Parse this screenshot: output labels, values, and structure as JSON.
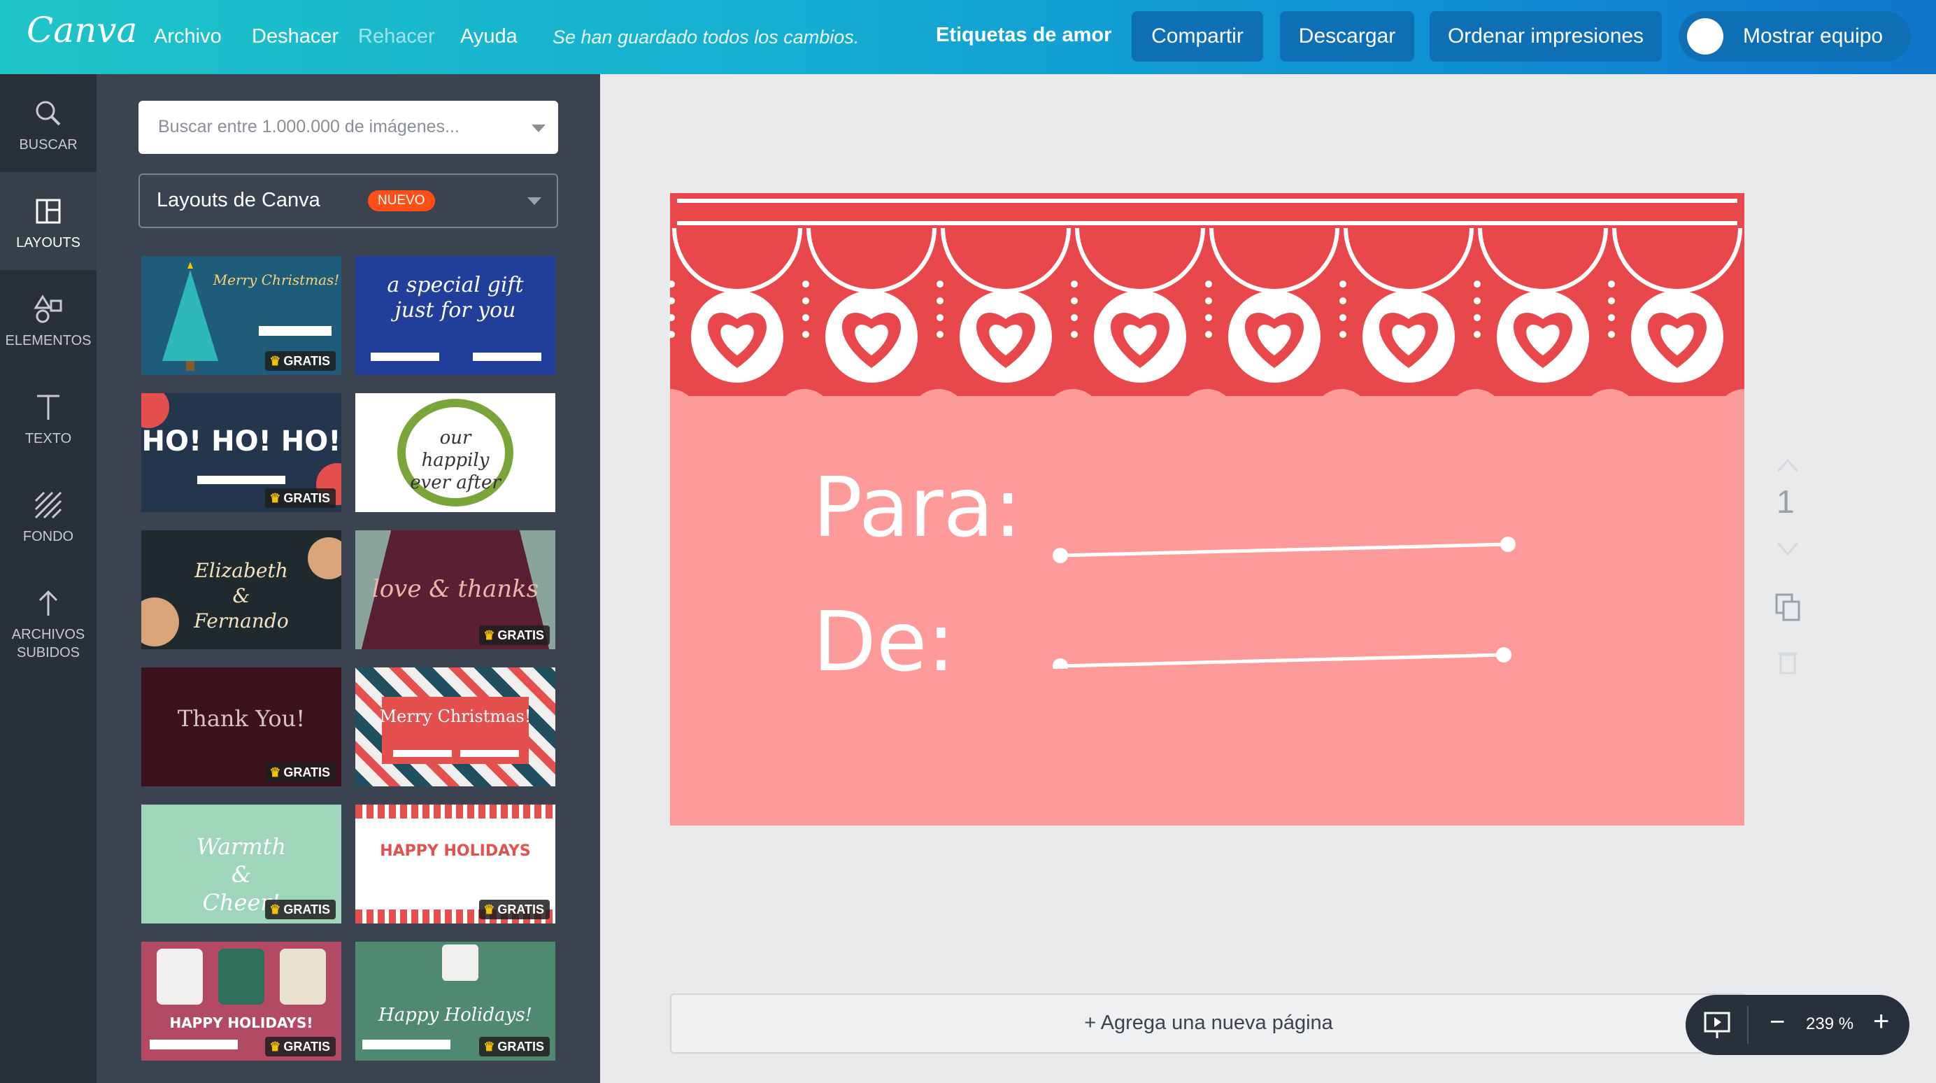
{
  "app": {
    "logo": "Canva"
  },
  "topbar": {
    "menu": [
      "Archivo",
      "Deshacer",
      "Rehacer",
      "Ayuda"
    ],
    "saved_status": "Se han guardado todos los cambios.",
    "document_name": "Etiquetas de amor",
    "share_label": "Compartir",
    "download_label": "Descargar",
    "print_label": "Ordenar impresiones",
    "team_label": "Mostrar equipo"
  },
  "sidebar": {
    "items": [
      {
        "label": "BUSCAR",
        "icon": "search-icon"
      },
      {
        "label": "LAYOUTS",
        "icon": "layouts-icon",
        "active": true
      },
      {
        "label": "ELEMENTOS",
        "icon": "elements-icon"
      },
      {
        "label": "TEXTO",
        "icon": "text-icon"
      },
      {
        "label": "FONDO",
        "icon": "background-icon"
      },
      {
        "label": "ARCHIVOS",
        "label2": "SUBIDOS",
        "icon": "upload-icon"
      }
    ]
  },
  "panel": {
    "search_placeholder": "Buscar entre 1.000.000 de imágenes...",
    "layout_select": "Layouts de Canva",
    "new_badge": "NUEVO",
    "free_badge": "GRATIS",
    "thumbnails": [
      {
        "title": "Merry Christmas!",
        "free": true
      },
      {
        "title": "a special gift just for you",
        "free": false
      },
      {
        "title": "HO! HO! HO!",
        "free": true
      },
      {
        "title": "our happily ever after",
        "free": false
      },
      {
        "title": "Elizabeth & Fernando",
        "free": false
      },
      {
        "title": "love & thanks",
        "free": true
      },
      {
        "title": "Thank You!",
        "free": true
      },
      {
        "title": "Merry Christmas!",
        "free": false
      },
      {
        "title": "Warmth & Cheer!",
        "free": true
      },
      {
        "title": "HAPPY HOLIDAYS",
        "free": true
      },
      {
        "title": "HAPPY HOLIDAYS!",
        "free": true
      },
      {
        "title": "Happy Holidays!",
        "free": true
      }
    ]
  },
  "canvas": {
    "para_label": "Para:",
    "de_label": "De:",
    "page_number": "1",
    "add_page_label": "+ Agrega una nueva página",
    "zoom": "239 %"
  },
  "colors": {
    "accent": "#1ec5c8",
    "card_bg": "#ff9a9a",
    "lace": "#e8474c",
    "badge": "#ff4f17"
  }
}
